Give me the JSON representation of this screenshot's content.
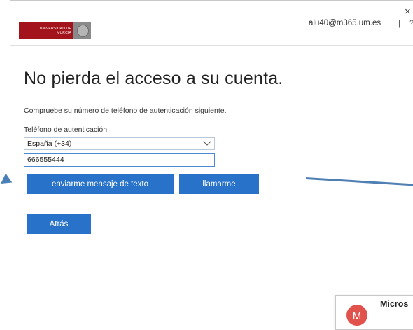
{
  "window": {
    "close_glyph": "×"
  },
  "header": {
    "logo_line1": "UNIVERSIDAD DE",
    "logo_line2": "MURCIA",
    "user_email": "alu40@m365.um.es",
    "separator": "|",
    "trailing": "?"
  },
  "main": {
    "title": "No pierda el acceso a su cuenta.",
    "instructions": "Compruebe su número de teléfono de autenticación siguiente.",
    "phone_label": "Teléfono de autenticación",
    "country_select": {
      "selected": "España (+34)"
    },
    "phone_input": {
      "value": "666555444"
    },
    "buttons": {
      "sms": "enviarme mensaje de texto",
      "call": "llamarme",
      "back": "Atrás"
    }
  },
  "toast": {
    "avatar_letter": "M",
    "text": "Micros"
  },
  "colors": {
    "accent": "#2873c9",
    "brand": "#a3131b",
    "annotation": "#4f7fb3"
  }
}
